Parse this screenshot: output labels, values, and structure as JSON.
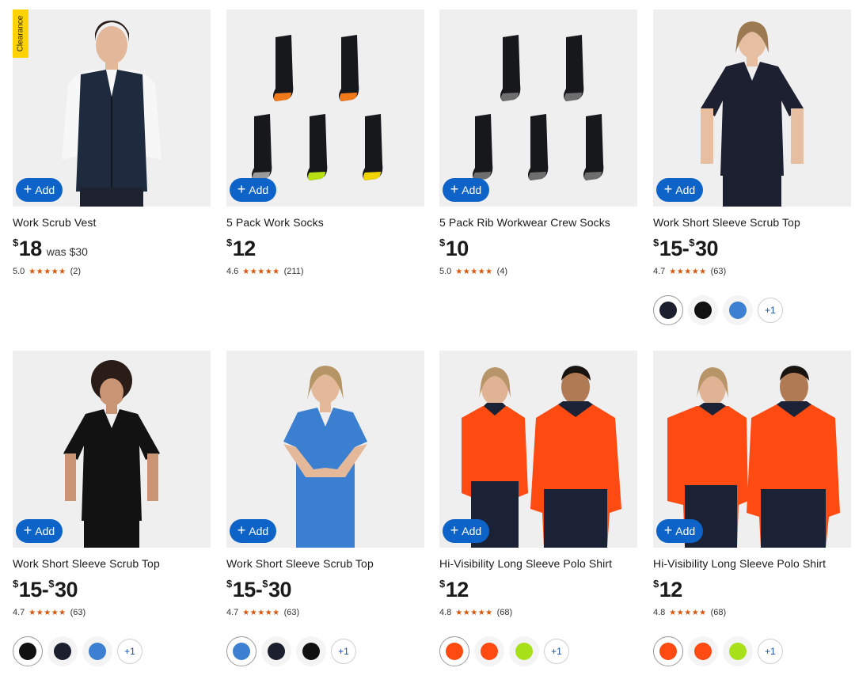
{
  "products": [
    {
      "title": "Work Scrub Vest",
      "currency": "$",
      "price_low": "18",
      "price_high": "",
      "was": "was $30",
      "rating": "5.0",
      "stars": "★★★★★",
      "reviews": "(2)",
      "badge": "Clearance",
      "add_label": "Add",
      "swatches": []
    },
    {
      "title": "5 Pack Work Socks",
      "currency": "$",
      "price_low": "12",
      "price_high": "",
      "was": "",
      "rating": "4.6",
      "stars": "★★★★★",
      "reviews": "(211)",
      "add_label": "Add",
      "swatches": []
    },
    {
      "title": "5 Pack Rib Workwear Crew Socks",
      "currency": "$",
      "price_low": "10",
      "price_high": "",
      "was": "",
      "rating": "5.0",
      "stars": "★★★★★",
      "reviews": "(4)",
      "add_label": "Add",
      "swatches": []
    },
    {
      "title": "Work Short Sleeve Scrub Top",
      "currency": "$",
      "price_low": "15",
      "price_high": "30",
      "was": "",
      "rating": "4.7",
      "stars": "★★★★★",
      "reviews": "(63)",
      "add_label": "Add",
      "swatches": [
        "#1b1f2e",
        "#111111",
        "#3d7fd1"
      ],
      "more_colors": "+1"
    },
    {
      "title": "Work Short Sleeve Scrub Top",
      "currency": "$",
      "price_low": "15",
      "price_high": "30",
      "was": "",
      "rating": "4.7",
      "stars": "★★★★★",
      "reviews": "(63)",
      "add_label": "Add",
      "swatches": [
        "#111111",
        "#1b1f2e",
        "#3d7fd1"
      ],
      "more_colors": "+1"
    },
    {
      "title": "Work Short Sleeve Scrub Top",
      "currency": "$",
      "price_low": "15",
      "price_high": "30",
      "was": "",
      "rating": "4.7",
      "stars": "★★★★★",
      "reviews": "(63)",
      "add_label": "Add",
      "swatches": [
        "#3d7fd1",
        "#1b1f2e",
        "#111111"
      ],
      "more_colors": "+1"
    },
    {
      "title": "Hi-Visibility Long Sleeve Polo Shirt",
      "currency": "$",
      "price_low": "12",
      "price_high": "",
      "was": "",
      "rating": "4.8",
      "stars": "★★★★★",
      "reviews": "(68)",
      "add_label": "Add",
      "swatches": [
        "#ff4a12",
        "#ff4a12",
        "#a8e01a"
      ],
      "more_colors": "+1"
    },
    {
      "title": "Hi-Visibility Long Sleeve Polo Shirt",
      "currency": "$",
      "price_low": "12",
      "price_high": "",
      "was": "",
      "rating": "4.8",
      "stars": "★★★★★",
      "reviews": "(68)",
      "add_label": "Add",
      "swatches": [
        "#ff4a12",
        "#ff4a12",
        "#a8e01a"
      ],
      "more_colors": "+1"
    }
  ],
  "theme": {
    "add_button": "#0d63c8",
    "star_color": "#d7560b",
    "badge_color": "#ffd200",
    "image_bg": "#efefef"
  },
  "image_icons": [
    "vest-photo-icon",
    "socks-photo-icon",
    "socks-photo-icon",
    "scrub-top-photo-icon",
    "scrub-top-photo-icon",
    "scrub-top-photo-icon",
    "polo-shirt-photo-icon",
    "polo-shirt-photo-icon"
  ]
}
